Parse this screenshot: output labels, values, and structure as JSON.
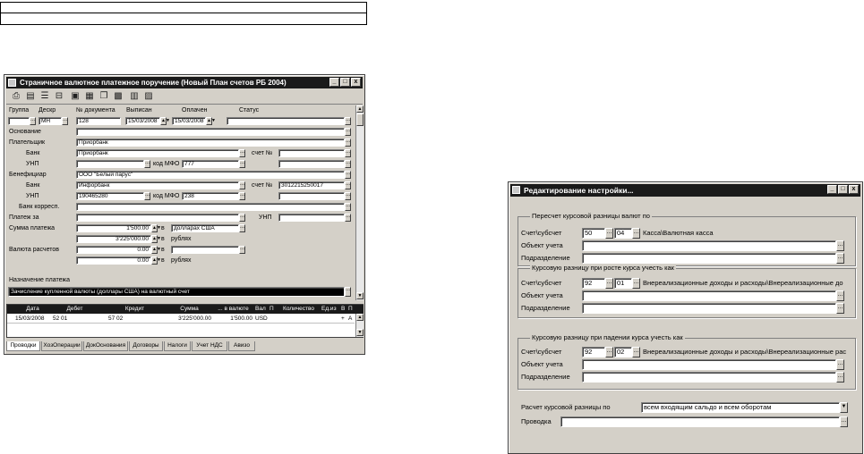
{
  "win1": {
    "title": "Страничное валютное платежное поручение (Новый План счетов РБ 2004)",
    "win_btns": [
      "_",
      "□",
      "x"
    ],
    "toolbar_icons": [
      "print-icon",
      "form-icon",
      "list-icon",
      "split-icon",
      "doc-icon",
      "doc2-icon",
      "copy-icon",
      "grid-icon",
      "table-icon",
      "card-icon"
    ],
    "headers": {
      "group": "Группа",
      "descr": "Дескр",
      "docnum": "№ документа",
      "issued": "Выписан",
      "paid": "Оплачен",
      "status": "Статус"
    },
    "values": {
      "descr": "МН",
      "docnum": "128",
      "issued": "15/03/2008",
      "paid": "15/03/2008",
      "payer": "Приорбанк",
      "payer_bank": "Приорбанк",
      "mfo_label": "код МФО",
      "payer_mfo": "777",
      "account_label": "счет №",
      "beneficiary": "ООО \"Белый парус\"",
      "ben_bank": "Инфорбанк",
      "ben_account": "3012215250017",
      "ben_unp": "190465280",
      "ben_mfo": "238",
      "amount": "1'500.00",
      "currency": "долларах США",
      "amount_rub": "3'225'000.00",
      "rubles": "рублях",
      "calc1": "0.00",
      "calc2": "0.00",
      "v_label": "в",
      "purpose": "Зачисление купленной валюты (доллары США) на валютный счет"
    },
    "labels": {
      "basis": "Основание",
      "payer": "Плательщик",
      "bank": "Банк",
      "unp": "УНП",
      "beneficiary": "Бенефициар",
      "corr_bank": "Банк корресп.",
      "pay_for": "Платеж за",
      "unp2": "УНП",
      "amount": "Сумма платежа",
      "calc_currency": "Валюта расчетов",
      "purpose": "Назначение платежа"
    },
    "grid": {
      "headers": [
        "Дата",
        "Дебет",
        "Кредит",
        "Сумма",
        "... в валюте",
        "Вал",
        "П",
        "Количество",
        "Ед.из",
        "В",
        "П"
      ],
      "row": [
        "15/03/2008",
        "52 01",
        "57 02",
        "3'225'000.00",
        "1'500.00",
        "USD",
        "",
        "",
        "",
        "+",
        "A"
      ]
    },
    "tabs": [
      "Проводки",
      "ХозОперации",
      "ДокОснования",
      "Договоры",
      "Налоги",
      "Учет НДС",
      "Авизо"
    ]
  },
  "win2": {
    "title": "Редактирование настройки...",
    "win_btns": [
      "_",
      "□",
      "x"
    ],
    "groups": [
      {
        "title": "Пересчет курсовой разницы валют по",
        "account": "50",
        "subaccount": "04",
        "account_name": "Касса\\Валютная касса"
      },
      {
        "title": "Курсовую разницу при росте курса учесть как",
        "account": "92",
        "subaccount": "01",
        "account_name": "Внереализационные доходы и расходы\\Внереализационные до"
      },
      {
        "title": "Курсовую разницу при падении курса учесть как",
        "account": "92",
        "subaccount": "02",
        "account_name": "Внереализационные доходы и расходы\\Внереализационные рас"
      }
    ],
    "labels": {
      "account": "Счет\\субсчет",
      "object": "Объект учета",
      "division": "Подразделение",
      "calc_by": "Расчет курсовой разницы по",
      "posting": "Проводка"
    },
    "calc_by_value": "всем входящим сальдо и всем оборотам"
  }
}
